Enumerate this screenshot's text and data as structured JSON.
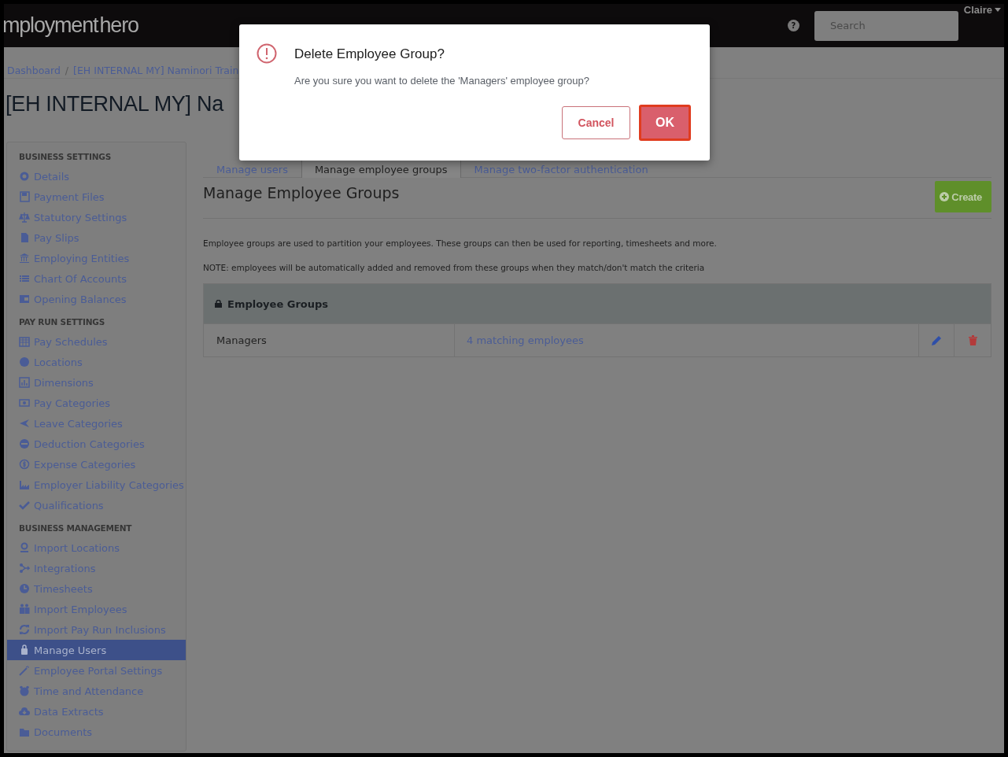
{
  "header": {
    "logo": "mployment hero",
    "help": "?",
    "search": {
      "placeholder": "Search"
    },
    "user": "Claire"
  },
  "breadcrumb": [
    "Dashboard",
    "[EH INTERNAL MY] Naminori Train"
  ],
  "breadcrumb_separator": "/",
  "page_title": "[EH INTERNAL MY] Na",
  "sidebar": {
    "sections": [
      {
        "title": "BUSINESS SETTINGS",
        "items": [
          {
            "label": "Details",
            "selected": false
          },
          {
            "label": "Payment Files",
            "selected": false
          },
          {
            "label": "Statutory Settings",
            "selected": false
          },
          {
            "label": "Pay Slips",
            "selected": false
          },
          {
            "label": "Employing Entities",
            "selected": false
          },
          {
            "label": "Chart Of Accounts",
            "selected": false
          },
          {
            "label": "Opening Balances",
            "selected": false
          }
        ]
      },
      {
        "title": "PAY RUN SETTINGS",
        "items": [
          {
            "label": "Pay Schedules",
            "selected": false
          },
          {
            "label": "Locations",
            "selected": false
          },
          {
            "label": "Dimensions",
            "selected": false
          },
          {
            "label": "Pay Categories",
            "selected": false
          },
          {
            "label": "Leave Categories",
            "selected": false
          },
          {
            "label": "Deduction Categories",
            "selected": false
          },
          {
            "label": "Expense Categories",
            "selected": false
          },
          {
            "label": "Employer Liability Categories",
            "selected": false
          },
          {
            "label": "Qualifications",
            "selected": false
          }
        ]
      },
      {
        "title": "BUSINESS MANAGEMENT",
        "items": [
          {
            "label": "Import Locations",
            "selected": false
          },
          {
            "label": "Integrations",
            "selected": false
          },
          {
            "label": "Timesheets",
            "selected": false
          },
          {
            "label": "Import Employees",
            "selected": false
          },
          {
            "label": "Import Pay Run Inclusions",
            "selected": false
          },
          {
            "label": "Manage Users",
            "selected": true
          },
          {
            "label": "Employee Portal Settings",
            "selected": false
          },
          {
            "label": "Time and Attendance",
            "selected": false
          },
          {
            "label": "Data Extracts",
            "selected": false
          },
          {
            "label": "Documents",
            "selected": false
          }
        ]
      }
    ]
  },
  "tabs": [
    {
      "label": "Manage users",
      "selected": false
    },
    {
      "label": "Manage employee groups",
      "selected": true
    },
    {
      "label": "Manage two-factor authentication",
      "selected": false
    }
  ],
  "section_title": "Manage Employee Groups",
  "create_button": "Create",
  "descriptions": [
    "Employee groups are used to partition your employees. These groups can then be used for reporting, timesheets and more.",
    "NOTE: employees will be automatically added and removed from these groups when they match/don't match the criteria"
  ],
  "table": {
    "title": "Employee Groups",
    "rows": [
      {
        "name": "Managers",
        "matches": "4 matching employees"
      }
    ]
  },
  "modal": {
    "title": "Delete Employee Group?",
    "message": "Are you sure you want to delete the 'Managers' employee group?",
    "buttons": [
      {
        "label": "Cancel",
        "kind": "secondary"
      },
      {
        "label": "OK",
        "kind": "primary"
      }
    ]
  }
}
